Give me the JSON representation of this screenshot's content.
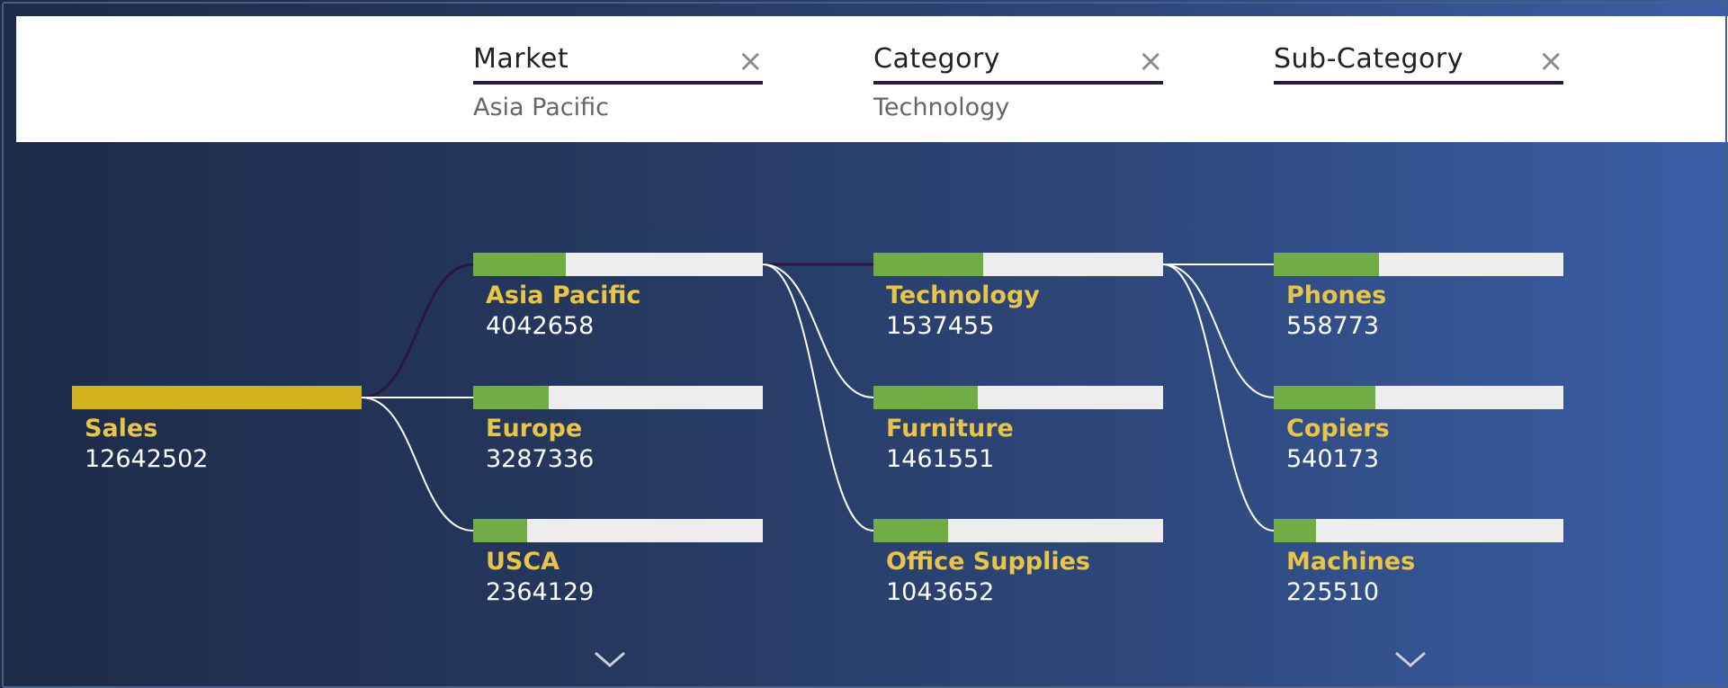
{
  "levels": [
    {
      "title": "Market",
      "selected": "Asia Pacific"
    },
    {
      "title": "Category",
      "selected": "Technology"
    },
    {
      "title": "Sub-Category",
      "selected": ""
    }
  ],
  "colors": {
    "root_bar": "#d4b21e",
    "fill": "#70ad47",
    "track": "#ededee",
    "label": "#e8c44a",
    "value": "#ffffff",
    "link": "#ffffff",
    "link_selected": "#2b1840"
  },
  "icons": {
    "close": "close-icon",
    "expand": "chevron-down-icon"
  },
  "chart_data": {
    "type": "decomposition-tree",
    "root": {
      "label": "Sales",
      "value": 12642502
    },
    "columns": [
      {
        "level": "Market",
        "selected_index": 0,
        "nodes": [
          {
            "label": "Asia Pacific",
            "value": 4042658
          },
          {
            "label": "Europe",
            "value": 3287336
          },
          {
            "label": "USCA",
            "value": 2364129
          }
        ]
      },
      {
        "level": "Category",
        "selected_index": 0,
        "nodes": [
          {
            "label": "Technology",
            "value": 1537455
          },
          {
            "label": "Furniture",
            "value": 1461551
          },
          {
            "label": "Office Supplies",
            "value": 1043652
          }
        ]
      },
      {
        "level": "Sub-Category",
        "selected_index": null,
        "nodes": [
          {
            "label": "Phones",
            "value": 558773
          },
          {
            "label": "Copiers",
            "value": 540173
          },
          {
            "label": "Machines",
            "value": 225510
          }
        ]
      }
    ]
  }
}
